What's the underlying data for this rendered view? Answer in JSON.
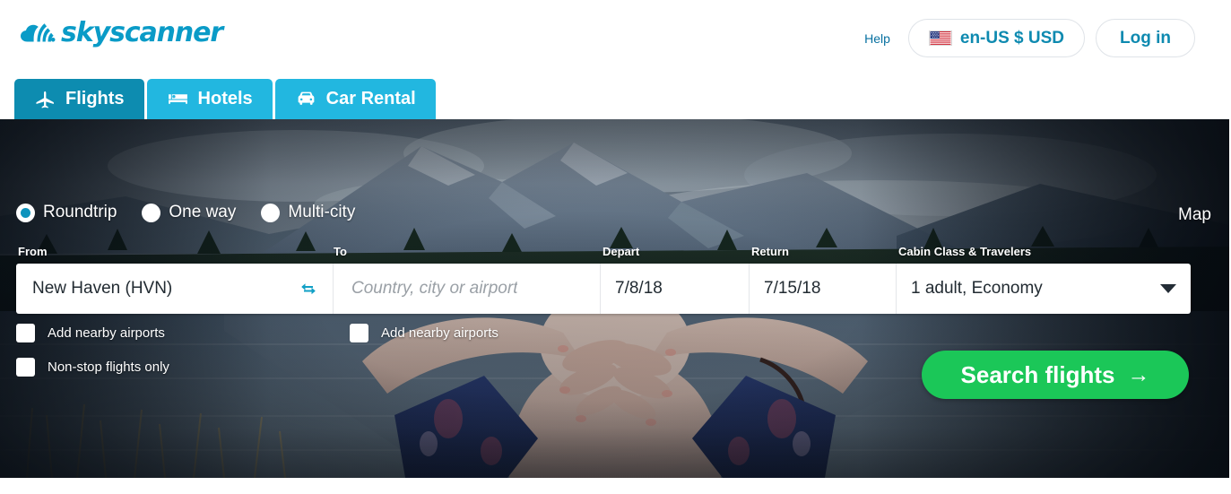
{
  "header": {
    "logo_text": "skyscanner",
    "logo_icon": "skyscanner-cloud-icon",
    "help_label": "Help",
    "locale_pill": {
      "flag_icon": "us-flag-icon",
      "label": "en-US $ USD"
    },
    "login_label": "Log in"
  },
  "tabs": [
    {
      "label": "Flights",
      "icon": "plane-icon",
      "active": true
    },
    {
      "label": "Hotels",
      "icon": "bed-icon",
      "active": false
    },
    {
      "label": "Car Rental",
      "icon": "car-icon",
      "active": false
    }
  ],
  "search": {
    "trip_types": [
      {
        "label": "Roundtrip",
        "selected": true
      },
      {
        "label": "One way",
        "selected": false
      },
      {
        "label": "Multi-city",
        "selected": false
      }
    ],
    "map_label": "Map",
    "labels": {
      "from": "From",
      "to": "To",
      "depart": "Depart",
      "return": "Return",
      "cabin": "Cabin Class & Travelers"
    },
    "from_value": "New Haven (HVN)",
    "to_value": "",
    "to_placeholder": "Country, city or airport",
    "depart_value": "7/8/18",
    "return_value": "7/15/18",
    "cabin_value": "1 adult, Economy",
    "swap_icon": "swap-arrows-icon",
    "cabin_caret_icon": "chevron-down-icon",
    "checkboxes": {
      "from_nearby": {
        "label": "Add nearby airports",
        "checked": false
      },
      "to_nearby": {
        "label": "Add nearby airports",
        "checked": false
      },
      "nonstop": {
        "label": "Non-stop flights only",
        "checked": false
      }
    },
    "submit_label": "Search flights",
    "submit_arrow": "→"
  },
  "colors": {
    "brand_teal": "#0a9bc7",
    "tab_active": "#0d8cb0",
    "tab_inactive": "#22b7e0",
    "accent_green": "#1bc758",
    "link_blue": "#0770a0"
  }
}
